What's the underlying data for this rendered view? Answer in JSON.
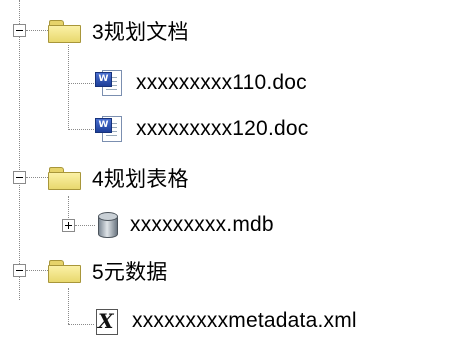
{
  "tree": {
    "folders": [
      {
        "label": "3规划文档",
        "icon": "folder-icon",
        "expanded": true,
        "children": [
          {
            "label": "xxxxxxxxx110.doc",
            "icon": "word-document-icon"
          },
          {
            "label": "xxxxxxxxx120.doc",
            "icon": "word-document-icon"
          }
        ]
      },
      {
        "label": "4规划表格",
        "icon": "folder-icon",
        "expanded": true,
        "children": [
          {
            "label": "xxxxxxxxx.mdb",
            "icon": "database-icon",
            "expanded": false
          }
        ]
      },
      {
        "label": "5元数据",
        "icon": "folder-icon",
        "expanded": true,
        "children": [
          {
            "label": "xxxxxxxxxmetadata.xml",
            "icon": "xml-file-icon"
          }
        ]
      }
    ]
  }
}
